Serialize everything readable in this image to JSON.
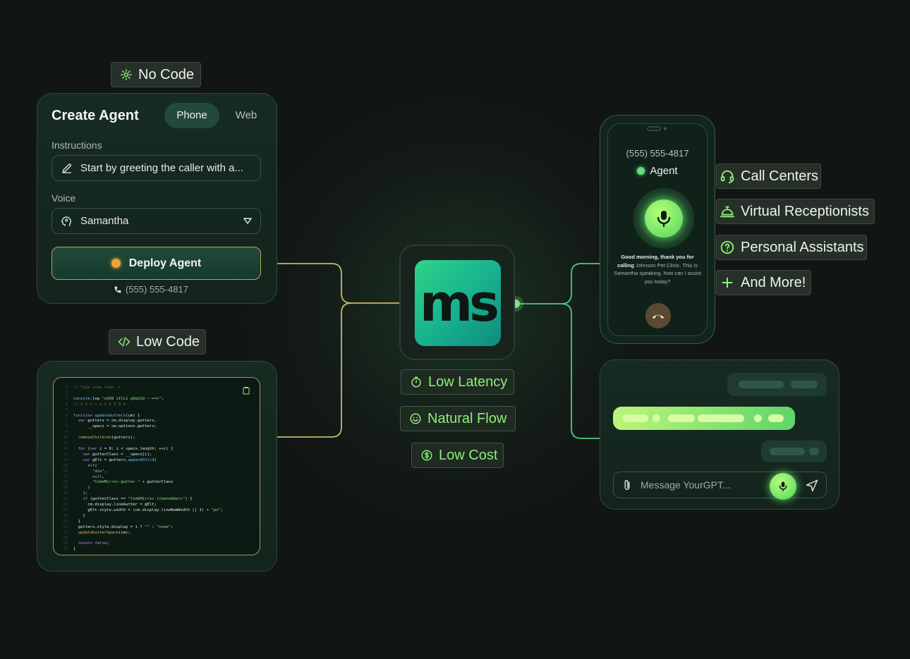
{
  "tags": {
    "no_code": "No Code",
    "low_code": "Low Code"
  },
  "create_agent": {
    "title": "Create Agent",
    "tab_phone": "Phone",
    "tab_web": "Web",
    "instructions_label": "Instructions",
    "instructions_value": "Start by greeting the caller with a...",
    "voice_label": "Voice",
    "voice_value": "Samantha",
    "deploy_button": "Deploy Agent",
    "phone_number": "(555) 555-4817"
  },
  "features": [
    "Low Latency",
    "Natural Flow",
    "Low Cost"
  ],
  "logo_text": "ms",
  "phone": {
    "number": "(555) 555-4817",
    "status": "Agent",
    "message_bold_1": "Good morning, thank you for calling",
    "message_rest": "Johnson Pet Clinic. This is Samantha speaking, how can I assist you today?"
  },
  "use_cases": [
    "Call Centers",
    "Virtual Receptionists",
    "Personal Assistants",
    "And More!"
  ],
  "chat": {
    "placeholder": "Message YourGPT..."
  },
  "colors": {
    "accent_green": "#8ef07a",
    "gold_wire": "#c9b66a",
    "green_wire": "#54c77a",
    "background": "#111513"
  }
}
